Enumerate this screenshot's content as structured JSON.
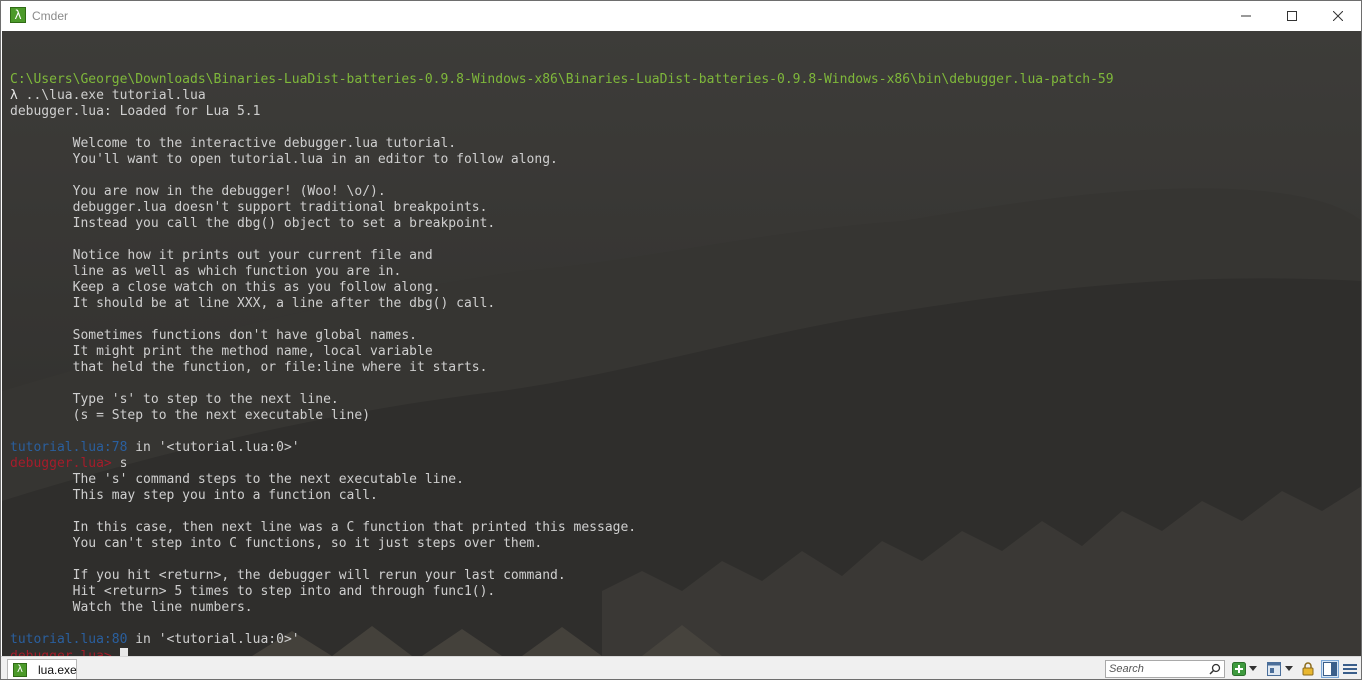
{
  "window": {
    "title": "Cmder",
    "app_icon_glyph": "λ"
  },
  "console": {
    "lines": [
      {
        "segments": [
          {
            "text": "",
            "style": "normal"
          }
        ]
      },
      {
        "segments": [
          {
            "text": "C:\\Users\\George\\Downloads\\Binaries-LuaDist-batteries-0.9.8-Windows-x86\\Binaries-LuaDist-batteries-0.9.8-Windows-x86\\bin\\debugger.lua-patch-59",
            "style": "path"
          }
        ]
      },
      {
        "segments": [
          {
            "text": "λ ",
            "style": "lambda"
          },
          {
            "text": "..\\lua.exe tutorial.lua",
            "style": "normal"
          }
        ]
      },
      {
        "segments": [
          {
            "text": "debugger.lua: Loaded for Lua 5.1",
            "style": "normal"
          }
        ]
      },
      {
        "segments": [
          {
            "text": "",
            "style": "normal"
          }
        ]
      },
      {
        "segments": [
          {
            "text": "        Welcome to the interactive debugger.lua tutorial.",
            "style": "normal"
          }
        ]
      },
      {
        "segments": [
          {
            "text": "        You'll want to open tutorial.lua in an editor to follow along.",
            "style": "normal"
          }
        ]
      },
      {
        "segments": [
          {
            "text": "",
            "style": "normal"
          }
        ]
      },
      {
        "segments": [
          {
            "text": "        You are now in the debugger! (Woo! \\o/).",
            "style": "normal"
          }
        ]
      },
      {
        "segments": [
          {
            "text": "        debugger.lua doesn't support traditional breakpoints.",
            "style": "normal"
          }
        ]
      },
      {
        "segments": [
          {
            "text": "        Instead you call the dbg() object to set a breakpoint.",
            "style": "normal"
          }
        ]
      },
      {
        "segments": [
          {
            "text": "",
            "style": "normal"
          }
        ]
      },
      {
        "segments": [
          {
            "text": "        Notice how it prints out your current file and",
            "style": "normal"
          }
        ]
      },
      {
        "segments": [
          {
            "text": "        line as well as which function you are in.",
            "style": "normal"
          }
        ]
      },
      {
        "segments": [
          {
            "text": "        Keep a close watch on this as you follow along.",
            "style": "normal"
          }
        ]
      },
      {
        "segments": [
          {
            "text": "        It should be at line XXX, a line after the dbg() call.",
            "style": "normal"
          }
        ]
      },
      {
        "segments": [
          {
            "text": "",
            "style": "normal"
          }
        ]
      },
      {
        "segments": [
          {
            "text": "        Sometimes functions don't have global names.",
            "style": "normal"
          }
        ]
      },
      {
        "segments": [
          {
            "text": "        It might print the method name, local variable",
            "style": "normal"
          }
        ]
      },
      {
        "segments": [
          {
            "text": "        that held the function, or file:line where it starts.",
            "style": "normal"
          }
        ]
      },
      {
        "segments": [
          {
            "text": "",
            "style": "normal"
          }
        ]
      },
      {
        "segments": [
          {
            "text": "        Type 's' to step to the next line.",
            "style": "normal"
          }
        ]
      },
      {
        "segments": [
          {
            "text": "        (s = Step to the next executable line)",
            "style": "normal"
          }
        ]
      },
      {
        "segments": [
          {
            "text": "",
            "style": "normal"
          }
        ]
      },
      {
        "segments": [
          {
            "text": "tutorial.lua:78",
            "style": "blue"
          },
          {
            "text": " in '<tutorial.lua:0>'",
            "style": "normal"
          }
        ]
      },
      {
        "segments": [
          {
            "text": "debugger.lua> ",
            "style": "red"
          },
          {
            "text": "s",
            "style": "normal"
          }
        ]
      },
      {
        "segments": [
          {
            "text": "        The 's' command steps to the next executable line.",
            "style": "normal"
          }
        ]
      },
      {
        "segments": [
          {
            "text": "        This may step you into a function call.",
            "style": "normal"
          }
        ]
      },
      {
        "segments": [
          {
            "text": "",
            "style": "normal"
          }
        ]
      },
      {
        "segments": [
          {
            "text": "        In this case, then next line was a C function that printed this message.",
            "style": "normal"
          }
        ]
      },
      {
        "segments": [
          {
            "text": "        You can't step into C functions, so it just steps over them.",
            "style": "normal"
          }
        ]
      },
      {
        "segments": [
          {
            "text": "",
            "style": "normal"
          }
        ]
      },
      {
        "segments": [
          {
            "text": "        If you hit <return>, the debugger will rerun your last command.",
            "style": "normal"
          }
        ]
      },
      {
        "segments": [
          {
            "text": "        Hit <return> 5 times to step into and through func1().",
            "style": "normal"
          }
        ]
      },
      {
        "segments": [
          {
            "text": "        Watch the line numbers.",
            "style": "normal"
          }
        ]
      },
      {
        "segments": [
          {
            "text": "",
            "style": "normal"
          }
        ]
      },
      {
        "segments": [
          {
            "text": "tutorial.lua:80",
            "style": "blue"
          },
          {
            "text": " in '<tutorial.lua:0>'",
            "style": "normal"
          }
        ]
      },
      {
        "segments": [
          {
            "text": "debugger.lua> ",
            "style": "red"
          }
        ],
        "cursor": true
      }
    ]
  },
  "statusbar": {
    "tab": {
      "label": "lua.exe",
      "icon_glyph": "λ"
    },
    "search": {
      "placeholder": "Search",
      "value": ""
    },
    "buttons": [
      {
        "name": "new-console-button",
        "icon": "plus-icon"
      },
      {
        "name": "new-console-dropdown",
        "icon": "chevron-down-icon"
      },
      {
        "name": "split-view-button",
        "icon": "window-icon"
      },
      {
        "name": "split-view-dropdown",
        "icon": "chevron-down-icon"
      },
      {
        "name": "lock-button",
        "icon": "lock-icon"
      },
      {
        "name": "layout-button",
        "icon": "panel-icon"
      },
      {
        "name": "menu-button",
        "icon": "hamburger-icon"
      }
    ]
  },
  "colors": {
    "path": "#7fb83b",
    "prompt_location": "#2a5f9e",
    "prompt_debugger": "#a51c2a",
    "text": "#cfcfcf",
    "accent_green": "#4c9a2a"
  }
}
